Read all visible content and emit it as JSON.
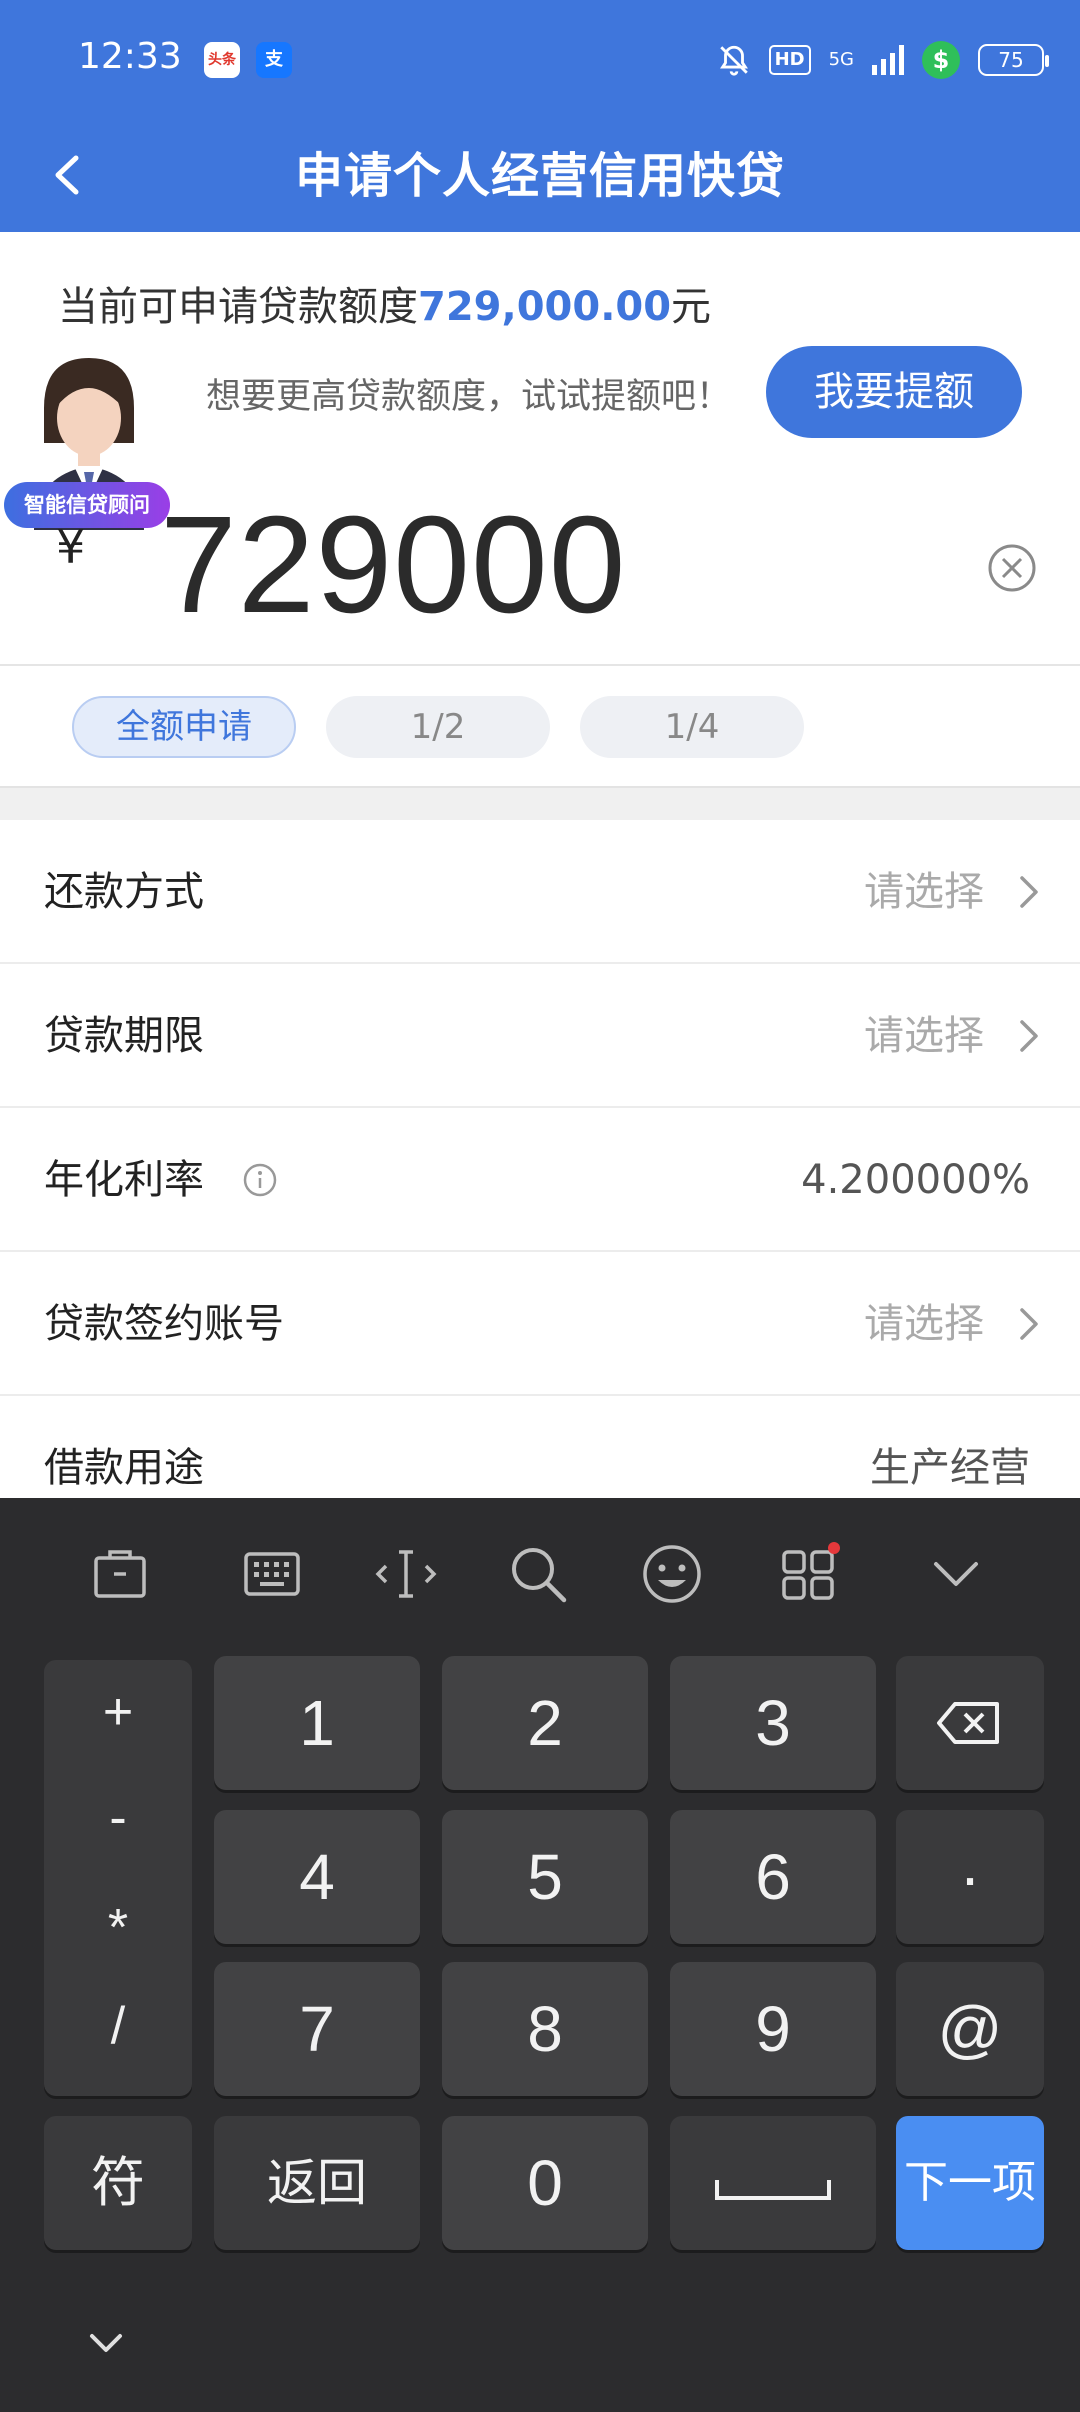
{
  "status_bar": {
    "time": "12:33",
    "apps": [
      {
        "icon": "toutiao-icon",
        "label": "头条"
      },
      {
        "icon": "alipay-icon",
        "label": "支"
      }
    ],
    "network": "5G",
    "hd": "HD",
    "battery": "75"
  },
  "header": {
    "title": "申请个人经营信用快贷"
  },
  "quota": {
    "prefix": "当前可申请贷款额度",
    "amount": "729,000.00",
    "suffix": "元"
  },
  "advisor": {
    "badge": "智能信贷顾问"
  },
  "hint": "想要更高贷款额度，试试提额吧！",
  "raise_button": "我要提额",
  "amount": {
    "currency": "¥",
    "value": "729000"
  },
  "chips": [
    {
      "label": "全额申请",
      "active": true
    },
    {
      "label": "1/2",
      "active": false
    },
    {
      "label": "1/4",
      "active": false
    }
  ],
  "form_rows": [
    {
      "label": "还款方式",
      "value": "请选择",
      "type": "select"
    },
    {
      "label": "贷款期限",
      "value": "请选择",
      "type": "select"
    },
    {
      "label": "年化利率",
      "value": "4.200000%",
      "type": "info"
    },
    {
      "label": "贷款签约账号",
      "value": "请选择",
      "type": "select"
    },
    {
      "label": "借款用途",
      "value": "生产经营",
      "type": "static"
    }
  ],
  "keyboard": {
    "toolbar": [
      "clipboard-icon",
      "keyboard-icon",
      "cursor-icon",
      "search-icon",
      "emoji-icon",
      "apps-icon",
      "collapse-icon"
    ],
    "ops": [
      "+",
      "-",
      "*",
      "/"
    ],
    "digits": [
      "1",
      "2",
      "3",
      "4",
      "5",
      "6",
      "7",
      "8",
      "9",
      "0"
    ],
    "dot": "·",
    "at": "@",
    "symbol": "符",
    "back": "返回",
    "next": "下一项"
  },
  "colors": {
    "brand": "#3f76dc",
    "keyboard_bg": "#2c2c2e",
    "key": "#424244",
    "next_key": "#4a8ef2"
  }
}
